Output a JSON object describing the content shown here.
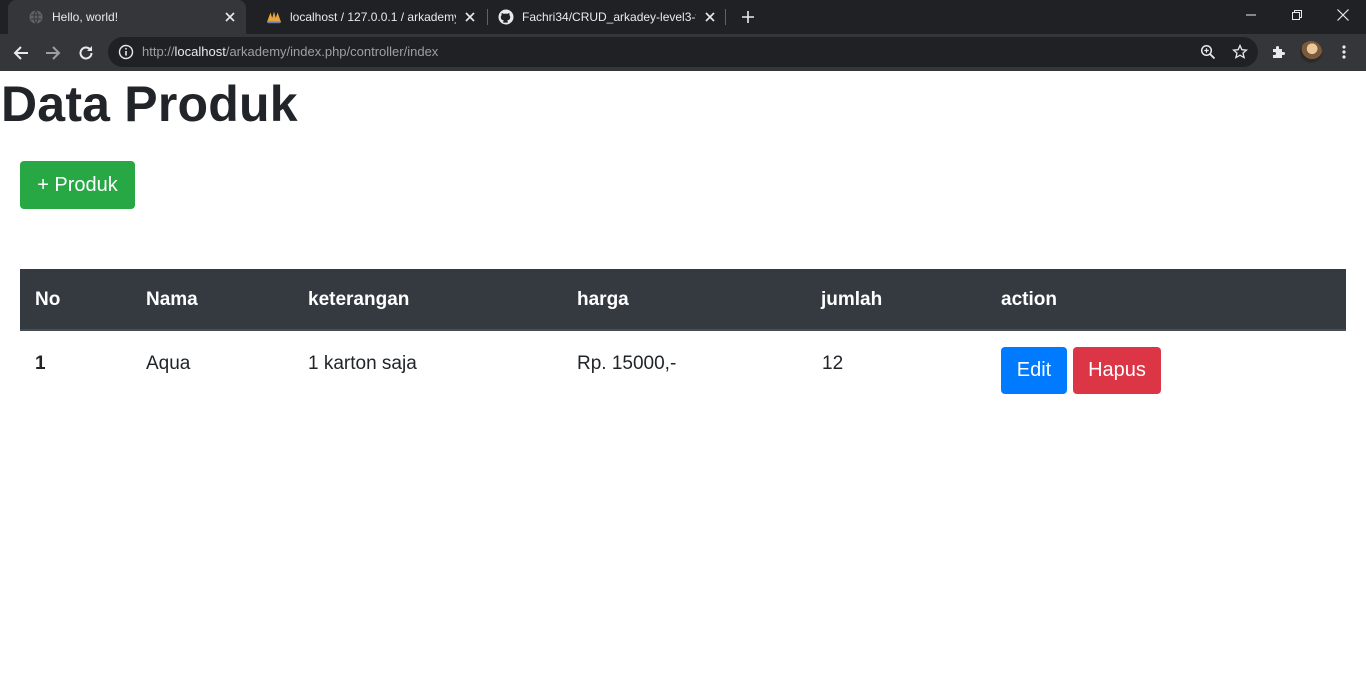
{
  "browser": {
    "tabs": [
      {
        "title": "Hello, world!",
        "favicon": "globe-icon"
      },
      {
        "title": "localhost / 127.0.0.1 / arkademy /",
        "favicon": "phpmyadmin-icon"
      },
      {
        "title": "Fachri34/CRUD_arkadey-level3-tu",
        "favicon": "github-icon"
      }
    ],
    "url": {
      "scheme": "http://",
      "host": "localhost",
      "path": "/arkademy/index.php/controller/index"
    }
  },
  "page": {
    "title": "Data Produk",
    "add_button": "+ Produk",
    "table": {
      "columns": [
        "No",
        "Nama",
        "keterangan",
        "harga",
        "jumlah",
        "action"
      ],
      "rows": [
        {
          "no": "1",
          "nama": "Aqua",
          "keterangan": "1 karton saja",
          "harga": "Rp. 15000,-",
          "jumlah": "12"
        }
      ],
      "edit_label": "Edit",
      "delete_label": "Hapus"
    }
  },
  "colors": {
    "success": "#28a745",
    "primary": "#007bff",
    "danger": "#dc3545",
    "table_header": "#343a40"
  }
}
